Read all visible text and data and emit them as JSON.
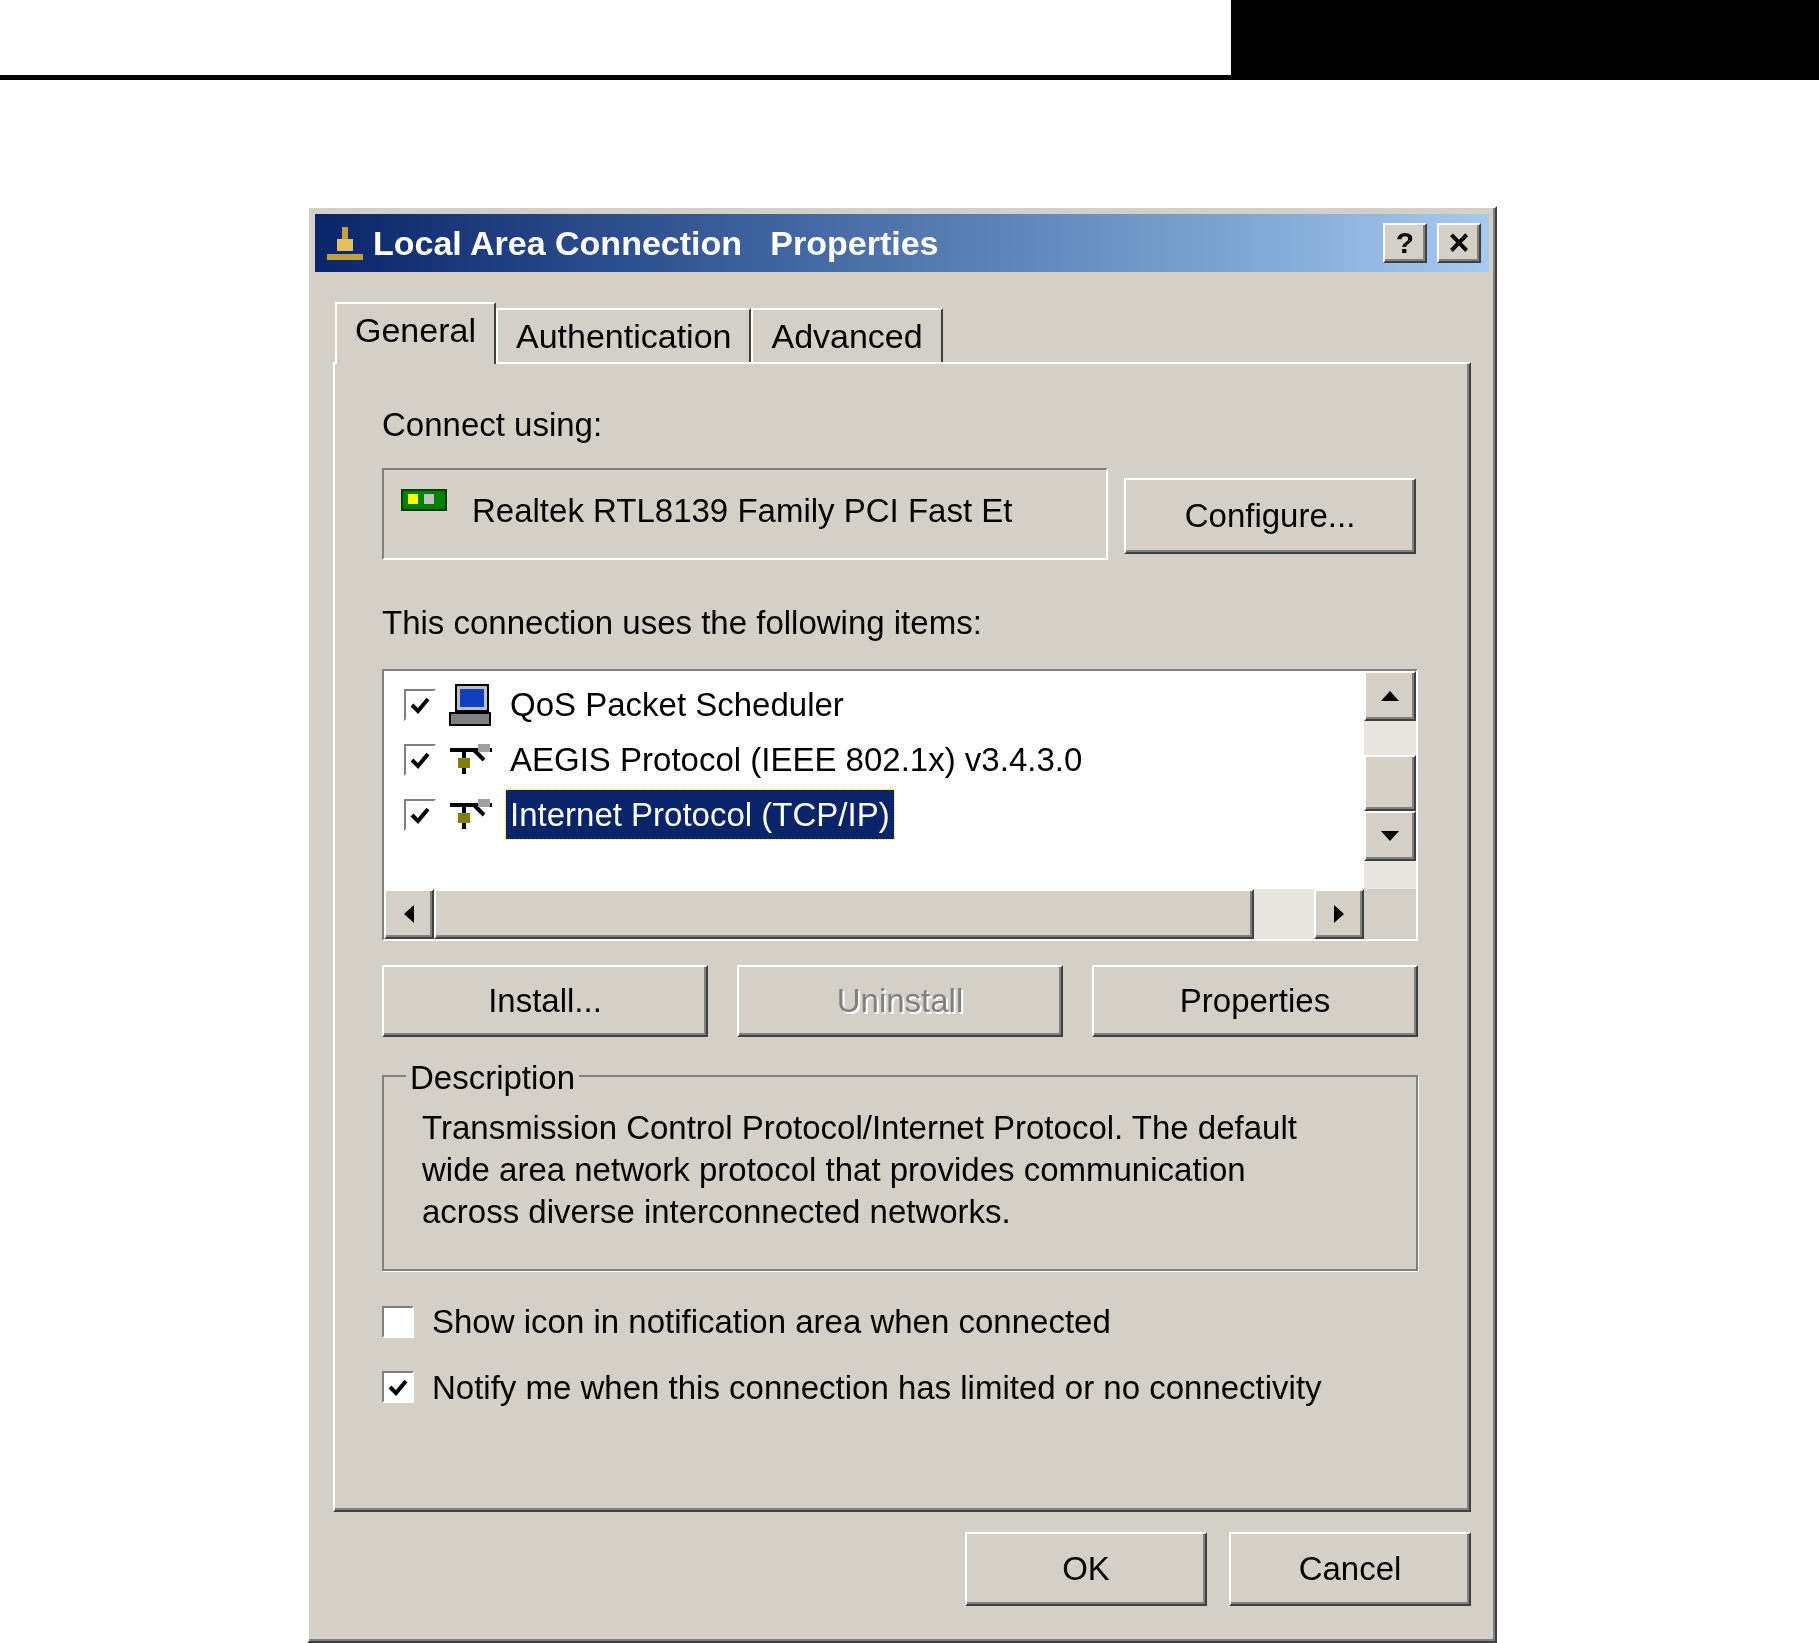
{
  "window": {
    "title": "Local Area Connection   Properties",
    "help": "?",
    "close": "×"
  },
  "tabs": [
    {
      "label": "General",
      "selected": true
    },
    {
      "label": "Authentication",
      "selected": false
    },
    {
      "label": "Advanced",
      "selected": false
    }
  ],
  "connect_using": {
    "label": "Connect using:",
    "adapter": "Realtek RTL8139 Family PCI Fast Et",
    "configure": {
      "label": "Configure..."
    }
  },
  "items_label": {
    "text": "This connection uses the following items:"
  },
  "items": [
    {
      "kind": "scheduler",
      "label": "QoS Packet Scheduler",
      "checked": true,
      "selected": false
    },
    {
      "kind": "protocol",
      "label": "AEGIS Protocol (IEEE 802.1x) v3.4.3.0",
      "checked": true,
      "selected": false
    },
    {
      "kind": "protocol",
      "label": "Internet Protocol (TCP/IP)",
      "checked": true,
      "selected": true
    }
  ],
  "item_buttons": [
    {
      "label": "Install...",
      "disabled": false
    },
    {
      "label": "Uninstall",
      "disabled": true
    },
    {
      "label": "Properties",
      "disabled": false
    }
  ],
  "description": {
    "title": "Description",
    "text": "Transmission Control Protocol/Internet Protocol. The default wide area network protocol that provides communication across diverse interconnected networks."
  },
  "options": [
    {
      "label": "Show icon in notification area when connected",
      "checked": false
    },
    {
      "label": "Notify me when this connection has limited or no connectivity",
      "checked": true
    }
  ],
  "buttons": [
    {
      "label": "OK"
    },
    {
      "label": "Cancel"
    }
  ]
}
